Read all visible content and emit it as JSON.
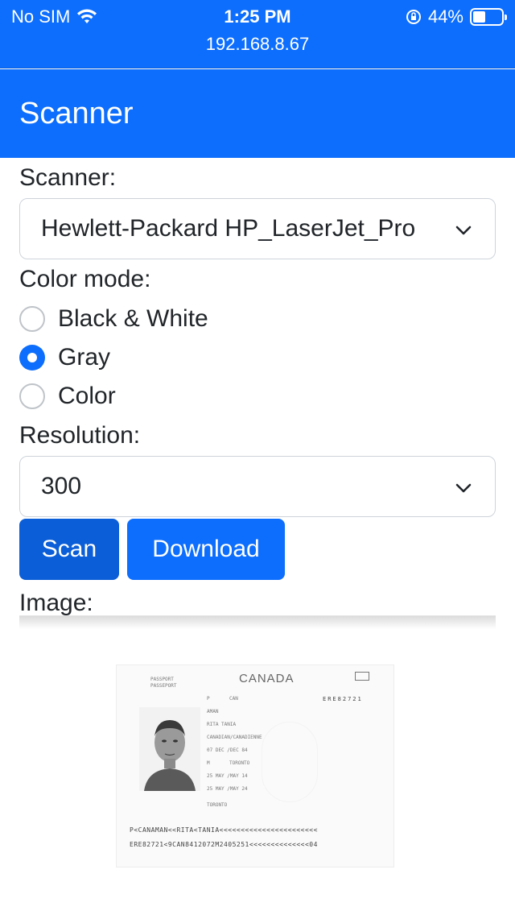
{
  "status_bar": {
    "carrier": "No SIM",
    "time": "1:25 PM",
    "url": "192.168.8.67",
    "battery_percent": "44%",
    "battery_level": 0.44
  },
  "navbar": {
    "brand": "Scanner"
  },
  "form": {
    "scanner_label": "Scanner:",
    "scanner_value": "Hewlett-Packard HP_LaserJet_Pro",
    "color_mode_label": "Color mode:",
    "color_modes": [
      {
        "label": "Black & White",
        "checked": false
      },
      {
        "label": "Gray",
        "checked": true
      },
      {
        "label": "Color",
        "checked": false
      }
    ],
    "resolution_label": "Resolution:",
    "resolution_value": "300",
    "scan_button": "Scan",
    "download_button": "Download",
    "image_label": "Image:"
  },
  "scanned_image": {
    "country": "CANADA",
    "header_left_1": "PASSPORT",
    "header_left_2": "PASSEPORT",
    "type": "P",
    "issuing_country": "CAN",
    "passport_no": "ERE82721",
    "surname": "AMAN",
    "given_names": "RITA TANIA",
    "nationality": "CANADIAN/CANADIENNE",
    "date_of_birth": "07 DEC /DEC 84",
    "sex": "M",
    "place_of_birth": "TORONTO",
    "date_of_issue": "25 MAY /MAY 14",
    "date_of_expiry": "25 MAY /MAY 24",
    "issuing_authority": "TORONTO",
    "mrz_line_1": "P<CANAMAN<<RITA<TANIA<<<<<<<<<<<<<<<<<<<<<<<",
    "mrz_line_2": "ERE82721<9CAN8412072M2405251<<<<<<<<<<<<<<04"
  },
  "colors": {
    "primary": "#0d6efd",
    "primary_dark": "#0b5ed7"
  }
}
